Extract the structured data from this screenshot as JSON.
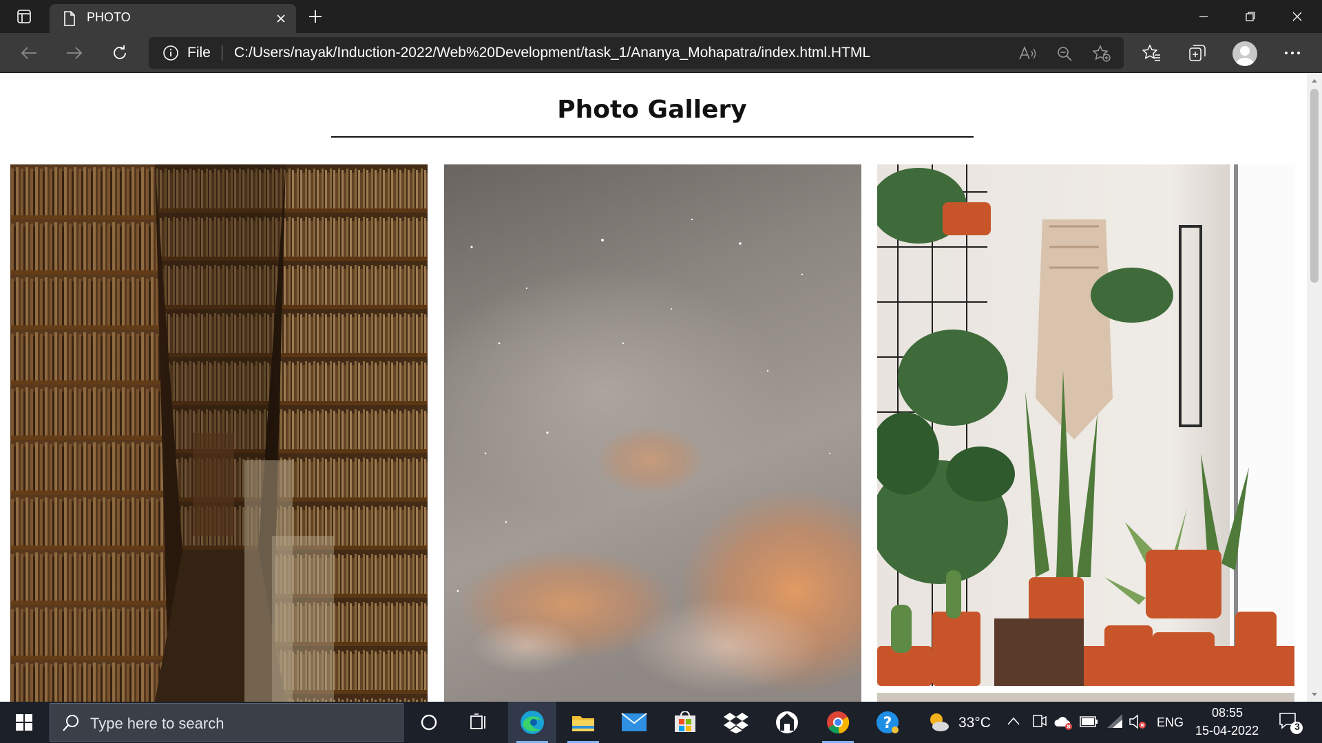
{
  "browser": {
    "tab_title": "PHOTO",
    "file_label": "File",
    "url": "C:/Users/nayak/Induction-2022/Web%20Development/task_1/Ananya_Mohapatra/index.html.HTML"
  },
  "page": {
    "title": "Photo Gallery",
    "photos": [
      {
        "subject": "bookshop aisle lined with shelves of books"
      },
      {
        "subject": "night sky with stars and orange clouds"
      },
      {
        "subject": "indoor plants in terracotta pots by a window"
      }
    ]
  },
  "taskbar": {
    "search_placeholder": "Type here to search",
    "temperature": "33°C",
    "language": "ENG",
    "time": "08:55",
    "date": "15-04-2022",
    "notification_count": "3"
  },
  "icons": [
    "tab-actions-icon",
    "page-icon",
    "close-icon",
    "plus-icon",
    "minimize-icon",
    "restore-icon",
    "back-icon",
    "forward-icon",
    "refresh-icon",
    "info-icon",
    "read-aloud-icon",
    "zoom-out-icon",
    "add-favorite-icon",
    "favorites-icon",
    "collections-icon",
    "profile-icon",
    "more-icon",
    "windows-icon",
    "search-icon",
    "cortana-icon",
    "task-view-icon",
    "edge-icon",
    "file-explorer-icon",
    "mail-icon",
    "store-icon",
    "dropbox-icon",
    "app-icon",
    "chrome-icon",
    "help-icon",
    "weather-icon",
    "chevron-up-icon",
    "meet-icon",
    "onedrive-icon",
    "battery-icon",
    "wifi-icon",
    "volume-icon",
    "notification-icon"
  ]
}
